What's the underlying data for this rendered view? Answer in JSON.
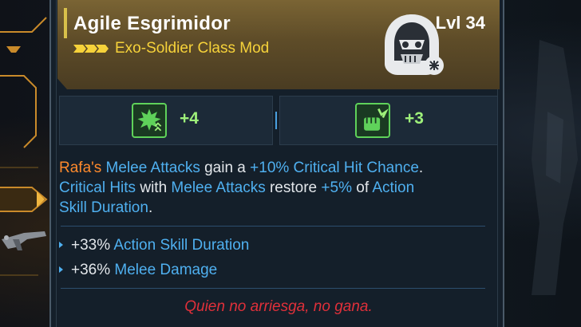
{
  "item": {
    "name": "Agile Esgrimidor",
    "type": "Exo-Soldier Class Mod",
    "level": "Lvl 34",
    "rarity_color": "#f6d23a",
    "class_icon": "hooded-skull-icon"
  },
  "skills": [
    {
      "icon": "spiky-burst-upgrade-icon",
      "value": "+4"
    },
    {
      "icon": "fist-impact-icon",
      "value": "+3"
    }
  ],
  "description": {
    "l1_a": "Rafa's",
    "l1_b": " ",
    "l1_c": "Melee Attacks",
    "l1_d": " gain a ",
    "l1_e": "+10% Critical Hit Chance",
    "l1_f": ".",
    "l2_a": "Critical Hits",
    "l2_b": " with ",
    "l2_c": "Melee Attacks",
    "l2_d": " restore ",
    "l2_e": "+5%",
    "l2_f": " of ",
    "l2_g": "Action",
    "l3_a": "Skill Duration",
    "l3_b": "."
  },
  "stats": [
    {
      "value": "+33%",
      "label": "Action Skill Duration"
    },
    {
      "value": "+36%",
      "label": "Melee Damage"
    }
  ],
  "flavor_text": "Quien no arriesga, no gana.",
  "colors": {
    "accent_orange": "#ff8a2c",
    "accent_blue": "#4fb0f0",
    "legendary_red": "#e0303a",
    "skill_green": "#9ef07a"
  }
}
